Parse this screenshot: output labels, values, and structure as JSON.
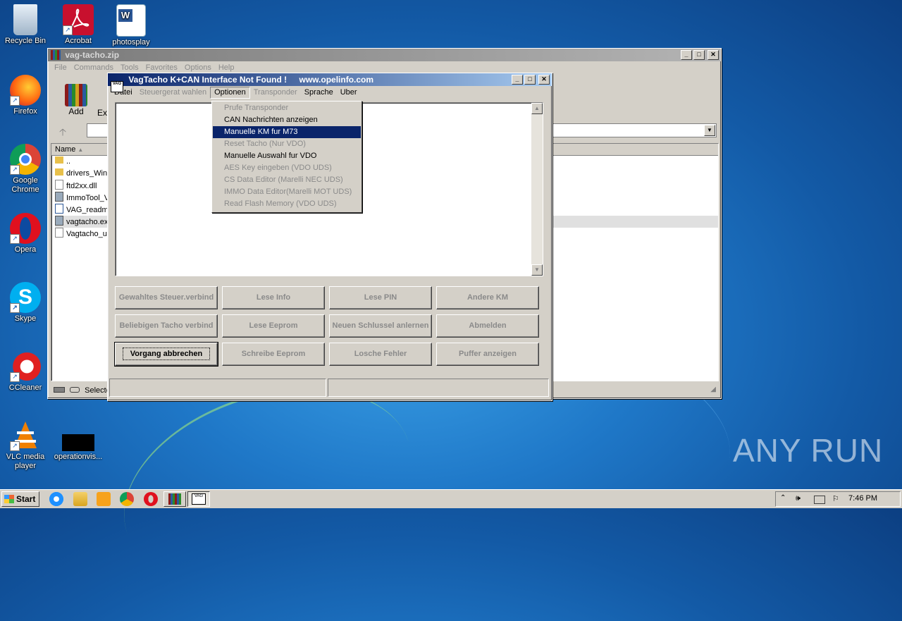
{
  "desktop": {
    "icons": [
      {
        "label": "Recycle Bin",
        "icon": "recycle-bin-icon"
      },
      {
        "label": "Acrobat",
        "icon": "acrobat-icon"
      },
      {
        "label": "photosplay",
        "icon": "word-doc-icon"
      },
      {
        "label": "Firefox",
        "icon": "firefox-icon"
      },
      {
        "label": "Google Chrome",
        "icon": "chrome-icon"
      },
      {
        "label": "Opera",
        "icon": "opera-icon"
      },
      {
        "label": "Skype",
        "icon": "skype-icon"
      },
      {
        "label": "CCleaner",
        "icon": "ccleaner-icon"
      },
      {
        "label": "VLC media player",
        "icon": "vlc-icon"
      },
      {
        "label": "operationvis...",
        "icon": "file-thumbnail-icon"
      }
    ],
    "watermark": "ANY RUN"
  },
  "winrar": {
    "title": "vag-tacho.zip",
    "menu": [
      "File",
      "Commands",
      "Tools",
      "Favorites",
      "Options",
      "Help"
    ],
    "toolbar": [
      "Add",
      "Ex"
    ],
    "column_name": "Name",
    "files": [
      "..",
      "drivers_Win",
      "ftd2xx.dll",
      "ImmoTool_V",
      "VAG_readme",
      "vagtacho.ex",
      "Vagtacho_u"
    ],
    "status": "Selecte"
  },
  "vagtacho": {
    "title": "VagTacho K+CAN  Interface Not Found !",
    "url": "www.opelinfo.com",
    "menu": [
      "Datei",
      "Steuergerat wahlen",
      "Optionen",
      "Transponder",
      "Sprache",
      "Uber"
    ],
    "buttons": [
      [
        "Gewahltes Steuer.verbind",
        "Lese Info",
        "Lese PIN",
        "Andere KM"
      ],
      [
        "Beliebigen Tacho verbind",
        "Lese Eeprom",
        "Neuen Schlussel anlernen",
        "Abmelden"
      ],
      [
        "Vorgang abbrechen",
        "Schreibe Eeprom",
        "Losche Fehler",
        "Puffer anzeigen"
      ]
    ]
  },
  "options_menu": {
    "items": [
      {
        "label": "Prufe Transponder",
        "enabled": false
      },
      {
        "label": "CAN Nachrichten anzeigen",
        "enabled": true
      },
      {
        "label": "Manuelle KM fur M73",
        "enabled": true,
        "highlighted": true
      },
      {
        "label": "Reset Tacho (Nur VDO)",
        "enabled": false
      },
      {
        "label": "Manuelle Auswahl fur VDO",
        "enabled": true
      },
      {
        "label": "AES Key eingeben (VDO UDS)",
        "enabled": false
      },
      {
        "label": "CS Data Editor (Marelli NEC UDS)",
        "enabled": false
      },
      {
        "label": "IMMO Data Editor(Marelli MOT UDS)",
        "enabled": false
      },
      {
        "label": "Read Flash Memory (VDO UDS)",
        "enabled": false
      }
    ]
  },
  "taskbar": {
    "start": "Start",
    "clock": "7:46 PM"
  },
  "colors": {
    "active_title": "#0a246a",
    "highlight": "#0a246a",
    "face": "#d4d0c8"
  }
}
